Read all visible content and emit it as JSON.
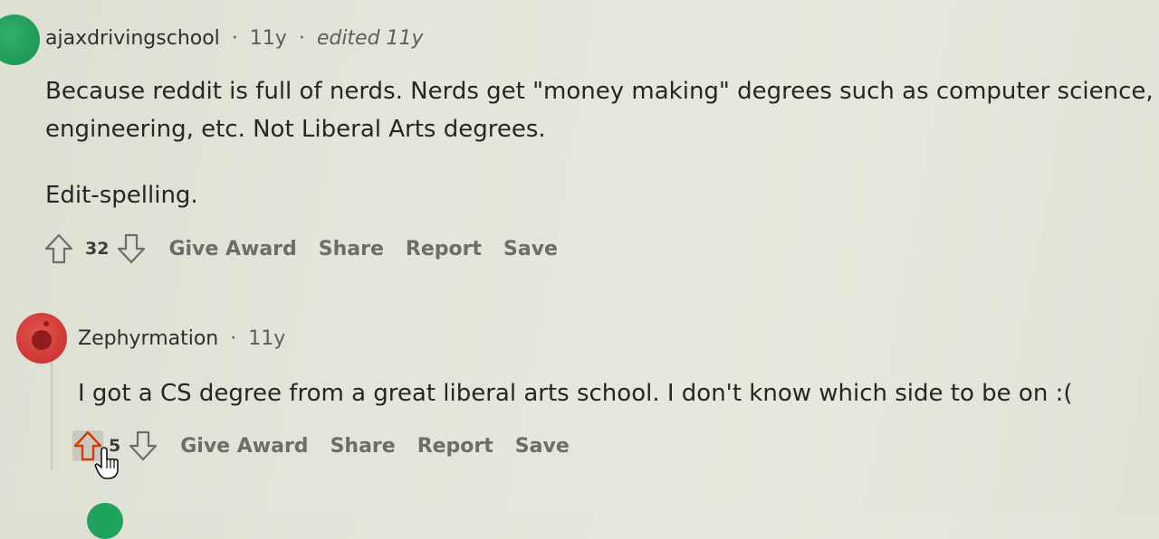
{
  "comments": [
    {
      "author": "ajaxdrivingschool",
      "age": "11y",
      "edited": "edited 11y",
      "body": [
        "Because reddit is full of nerds. Nerds get \"money making\" degrees such as computer science,",
        "engineering, etc. Not Liberal Arts degrees.",
        "Edit-spelling."
      ],
      "votes": "32",
      "actions": {
        "give_award": "Give Award",
        "share": "Share",
        "report": "Report",
        "save": "Save"
      }
    },
    {
      "author": "Zephyrmation",
      "age": "11y",
      "body": [
        "I got a CS degree from a great liberal arts school. I don't know which side to be on :("
      ],
      "votes": "5",
      "actions": {
        "give_award": "Give Award",
        "share": "Share",
        "report": "Report",
        "save": "Save"
      }
    }
  ],
  "meta_separator": "·",
  "colors": {
    "background": "#e3e6da",
    "upvote_active": "#d93a00",
    "avatar_green": "#1f9a57",
    "avatar_red": "#d23a37"
  },
  "icons": {
    "upvote": "upvote-arrow-icon",
    "downvote": "downvote-arrow-icon",
    "cursor": "hand-pointer-icon"
  }
}
